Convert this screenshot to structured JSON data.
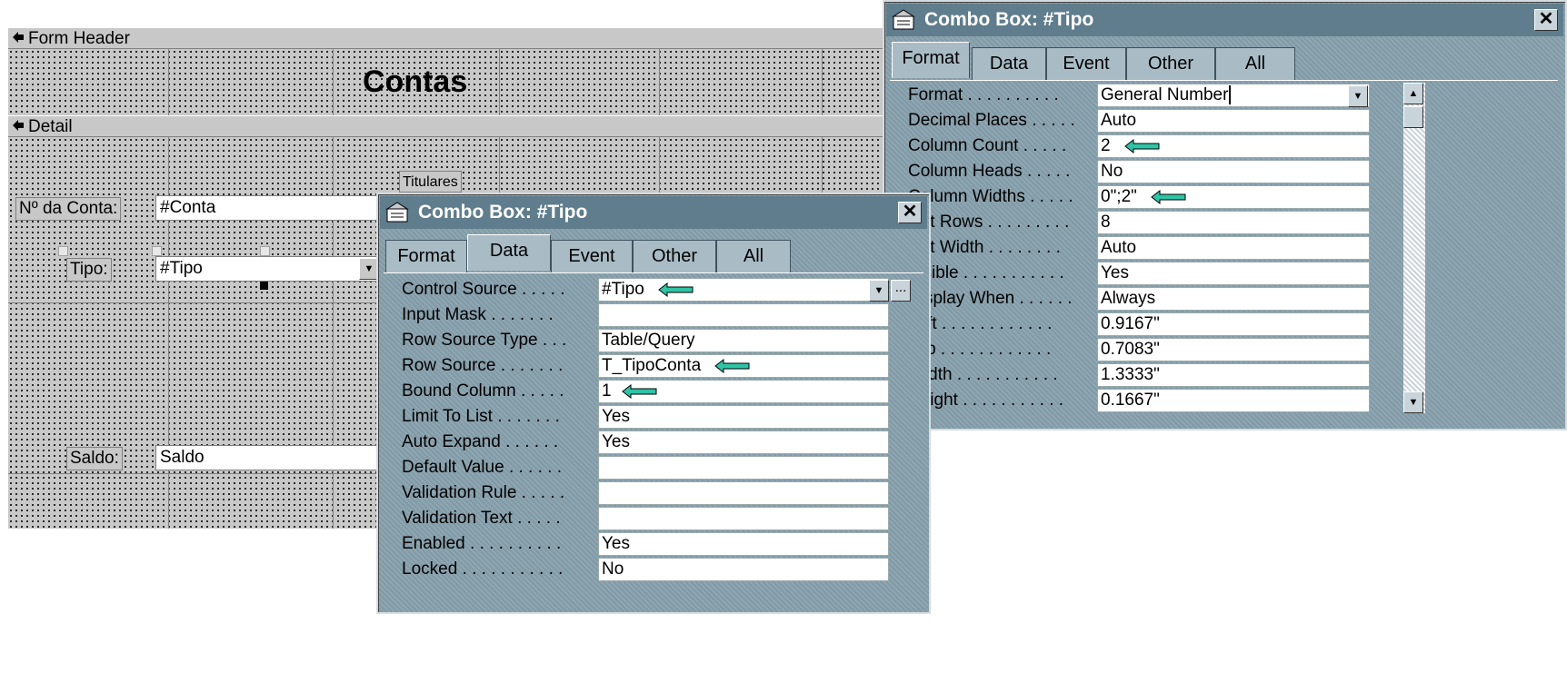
{
  "designer": {
    "form_header_label": "Form Header",
    "detail_label": "Detail",
    "title": "Contas",
    "titulares_label": "Titulares",
    "conta_label": "Nº da Conta:",
    "conta_value": "#Conta",
    "tipo_label": "Tipo:",
    "tipo_value": "#Tipo",
    "saldo_label": "Saldo:",
    "saldo_value": "Saldo"
  },
  "format_window": {
    "title": "Combo Box: #Tipo",
    "close": "✕",
    "tabs": [
      "Format",
      "Data",
      "Event",
      "Other",
      "All"
    ],
    "active_tab": "Format",
    "properties": [
      {
        "name": "Format . . . . . . . . . .",
        "value": "General Number"
      },
      {
        "name": "Decimal Places . . . . .",
        "value": "Auto"
      },
      {
        "name": "Column Count . . . . .",
        "value": "2"
      },
      {
        "name": "Column Heads . . . . .",
        "value": "No"
      },
      {
        "name": "Column Widths . . . . .",
        "value": "0\";2\""
      },
      {
        "name": "List Rows . . . . . . . . .",
        "value": "8"
      },
      {
        "name": "List Width . . . . . . . .",
        "value": "Auto"
      },
      {
        "name": "Visible . . . . . . . . . . .",
        "value": "Yes"
      },
      {
        "name": "Display When . . . . . .",
        "value": "Always"
      },
      {
        "name": "Left . . . . . . . . . . . .",
        "value": "0.9167\""
      },
      {
        "name": "Top . . . . . . . . . . . .",
        "value": "0.7083\""
      },
      {
        "name": "Width . . . . . . . . . . .",
        "value": "1.3333\""
      },
      {
        "name": "Height . . . . . . . . . . .",
        "value": "0.1667\""
      }
    ]
  },
  "data_window": {
    "title": "Combo Box: #Tipo",
    "close": "✕",
    "tabs": [
      "Format",
      "Data",
      "Event",
      "Other",
      "All"
    ],
    "active_tab": "Data",
    "builder_button": "...",
    "properties": [
      {
        "name": "Control Source . . . . .",
        "value": "#Tipo"
      },
      {
        "name": "Input Mask . . . . . . .",
        "value": ""
      },
      {
        "name": "Row Source Type . . .",
        "value": "Table/Query"
      },
      {
        "name": "Row Source . . . . . . .",
        "value": "T_TipoConta"
      },
      {
        "name": "Bound Column . . . . .",
        "value": "1"
      },
      {
        "name": "Limit To List . . . . . . .",
        "value": "Yes"
      },
      {
        "name": "Auto Expand . . . . . .",
        "value": "Yes"
      },
      {
        "name": "Default Value . . . . . .",
        "value": ""
      },
      {
        "name": "Validation Rule . . . . .",
        "value": ""
      },
      {
        "name": "Validation Text . . . . .",
        "value": ""
      },
      {
        "name": "Enabled . . . . . . . . . .",
        "value": "Yes"
      },
      {
        "name": "Locked . . . . . . . . . . .",
        "value": "No"
      }
    ]
  },
  "colors": {
    "window_body": "#87a0ad",
    "title_bar": "#5f7d8c",
    "arrow": "#2ec4a6",
    "grid": "#c8c8c8"
  }
}
